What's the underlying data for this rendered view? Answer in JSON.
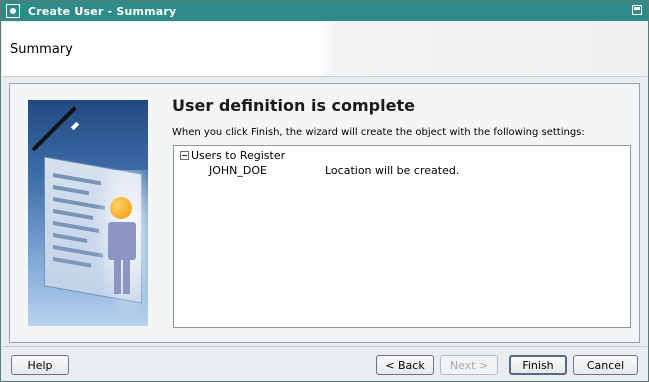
{
  "window": {
    "title": "Create User - Summary",
    "icons": {
      "system": "window-system-icon",
      "maximize": "maximize-icon"
    }
  },
  "header": {
    "title": "Summary"
  },
  "content": {
    "heading": "User definition is complete",
    "description": "When you click Finish, the wizard will create the object with the following settings:",
    "tree": {
      "root_label": "Users to Register",
      "items": [
        {
          "name": "JOHN_DOE",
          "status": "Location will be created."
        }
      ]
    }
  },
  "buttons": {
    "help": "Help",
    "back": "< Back",
    "next": "Next >",
    "finish": "Finish",
    "cancel": "Cancel"
  },
  "colors": {
    "titlebar": "#2f8b87",
    "accent": "#214a83"
  }
}
